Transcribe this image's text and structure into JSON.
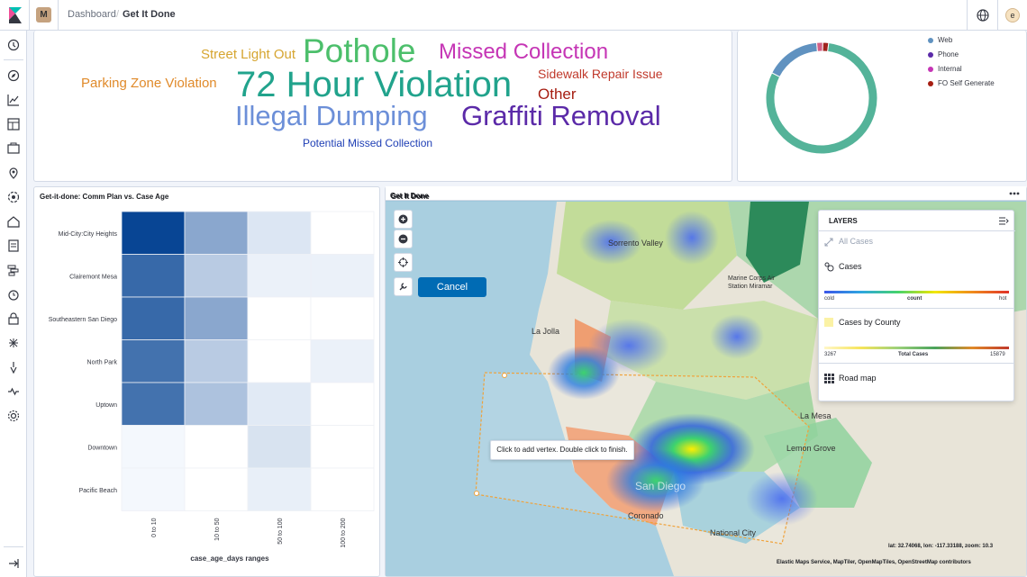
{
  "header": {
    "space_badge": "M",
    "breadcrumb_dashboard": "Dashboard",
    "breadcrumb_separator": "/",
    "breadcrumb_current": "Get It Done",
    "avatar_initial": "e"
  },
  "sidenav": {
    "icons": [
      "recently-viewed-icon",
      "discover-icon",
      "visualize-icon",
      "dashboard-icon",
      "canvas-icon",
      "maps-icon",
      "ml-icon",
      "infrastructure-icon",
      "logs-icon",
      "apm-icon",
      "uptime-icon",
      "siem-icon",
      "dev-tools-icon",
      "stack-monitoring-icon",
      "management-icon",
      "collapse-icon"
    ]
  },
  "tagcloud": {
    "words": [
      {
        "text": "Street Light Out",
        "color": "#d6a530"
      },
      {
        "text": "Pothole",
        "color": "#4cbf6b"
      },
      {
        "text": "Missed Collection",
        "color": "#c535b5"
      },
      {
        "text": "Parking Zone Violation",
        "color": "#e08a2a"
      },
      {
        "text": "72 Hour Violation",
        "color": "#21a38c"
      },
      {
        "text": "Sidewalk Repair Issue",
        "color": "#c0392b"
      },
      {
        "text": "Other",
        "color": "#a61e12"
      },
      {
        "text": "Illegal Dumping",
        "color": "#6c8fd8"
      },
      {
        "text": "Graffiti Removal",
        "color": "#5b2aa8"
      },
      {
        "text": "Potential Missed Collection",
        "color": "#1f3fb5"
      }
    ]
  },
  "donut": {
    "slices": [
      {
        "name": "Web",
        "value": 70,
        "color": "#54b399"
      },
      {
        "name": "Phone",
        "value": 14,
        "color": "#6092c0"
      },
      {
        "name": "Internal",
        "value": 1.5,
        "color": "#d36086"
      },
      {
        "name": "FO Self Generate",
        "value": 1.5,
        "color": "#a0231e"
      }
    ],
    "legend": [
      {
        "label": "Web",
        "color": "#6092c0"
      },
      {
        "label": "Phone",
        "color": "#5b2aa8"
      },
      {
        "label": "Internal",
        "color": "#c535b5"
      },
      {
        "label": "FO Self Generate",
        "color": "#a61e12"
      }
    ]
  },
  "chart_data": {
    "type": "heatmap",
    "title": "Get-it-done: Comm Plan vs. Case Age",
    "xlabel": "case_age_days ranges",
    "ylabel": "",
    "x": [
      "0 to 10",
      "10 to 50",
      "50 to 100",
      "100 to 200"
    ],
    "y": [
      "Mid-City:City Heights",
      "Clairemont Mesa",
      "Southeastern San Diego",
      "North Park",
      "Uptown",
      "Downtown",
      "Pacific Beach"
    ],
    "values": [
      [
        1.0,
        0.45,
        0.1,
        null
      ],
      [
        0.8,
        0.25,
        0.04,
        0.04
      ],
      [
        0.8,
        0.45,
        null,
        null
      ],
      [
        0.75,
        0.25,
        null,
        0.04
      ],
      [
        0.75,
        0.3,
        0.08,
        null
      ],
      [
        0.0,
        null,
        0.12,
        null
      ],
      [
        0.0,
        null,
        0.05,
        null
      ]
    ]
  },
  "map": {
    "title": "Get It Done",
    "options_icon": "ellipsis-icon",
    "cancel_label": "Cancel",
    "tooltip": "Click to add vertex. Double click to finish.",
    "coords": "lat: 32.74068, lon: -117.33188, zoom: 10.3",
    "attribution": "Elastic Maps Service, MapTiler, OpenMapTiles, OpenStreetMap contributors",
    "labels": [
      {
        "text": "Sorrento Valley"
      },
      {
        "text": "Marine Corps Air Station Miramar"
      },
      {
        "text": "La Jolla"
      },
      {
        "text": "La Mesa"
      },
      {
        "text": "Lemon Grove"
      },
      {
        "text": "Coronado"
      },
      {
        "text": "National City"
      },
      {
        "text": "San Diego"
      }
    ],
    "layers": {
      "header": "LAYERS",
      "items": [
        {
          "label": "All Cases"
        },
        {
          "label": "Cases"
        },
        {
          "label": "Cases by County"
        },
        {
          "label": "Road map"
        }
      ],
      "cases_legend": {
        "min": "cold",
        "mid": "count",
        "max": "hot"
      },
      "county_legend": {
        "min": "3267",
        "mid": "Total Cases",
        "max": "15879"
      }
    }
  }
}
